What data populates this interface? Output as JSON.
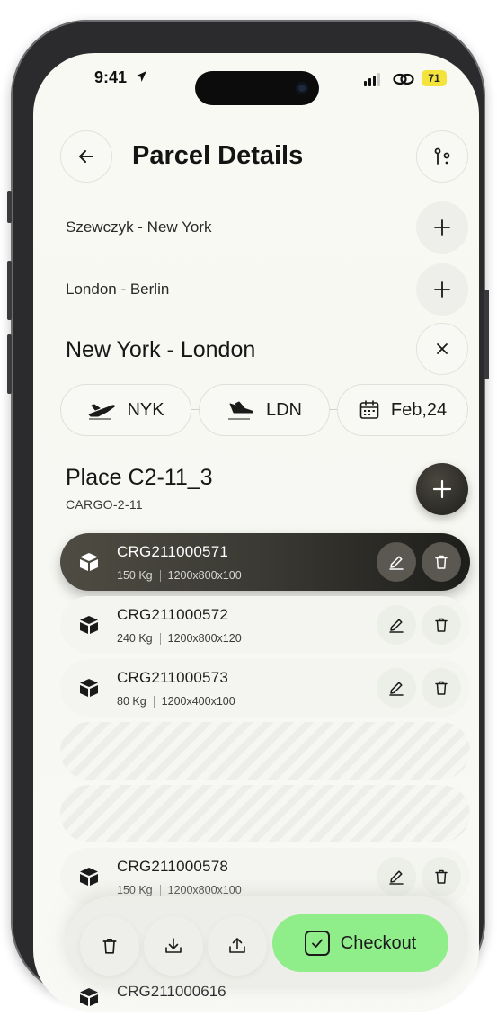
{
  "status_bar": {
    "time": "9:41",
    "battery": "71"
  },
  "header": {
    "title": "Parcel Details"
  },
  "routes": [
    {
      "label": "Szewczyk - New York"
    },
    {
      "label": "London - Berlin"
    }
  ],
  "active_route": {
    "label": "New York - London",
    "from": "NYK",
    "to": "LDN",
    "date": "Feb,24"
  },
  "place": {
    "title": "Place C2-11_3",
    "subtitle": "CARGO-2-11"
  },
  "parcels": [
    {
      "code": "CRG211000571",
      "weight": "150 Kg",
      "dims": "1200x800x100"
    },
    {
      "code": "CRG211000572",
      "weight": "240 Kg",
      "dims": "1200x800x120"
    },
    {
      "code": "CRG211000573",
      "weight": "80 Kg",
      "dims": "1200x400x100"
    },
    {
      "code": "CRG211000578",
      "weight": "150 Kg",
      "dims": "1200x800x100"
    },
    {
      "code": "CRG211000616"
    }
  ],
  "actions": {
    "checkout_label": "Checkout"
  },
  "colors": {
    "checkout_bg": "#8fed8a",
    "selected_row_bg": "#3a3933",
    "battery_bg": "#f3e33c"
  }
}
